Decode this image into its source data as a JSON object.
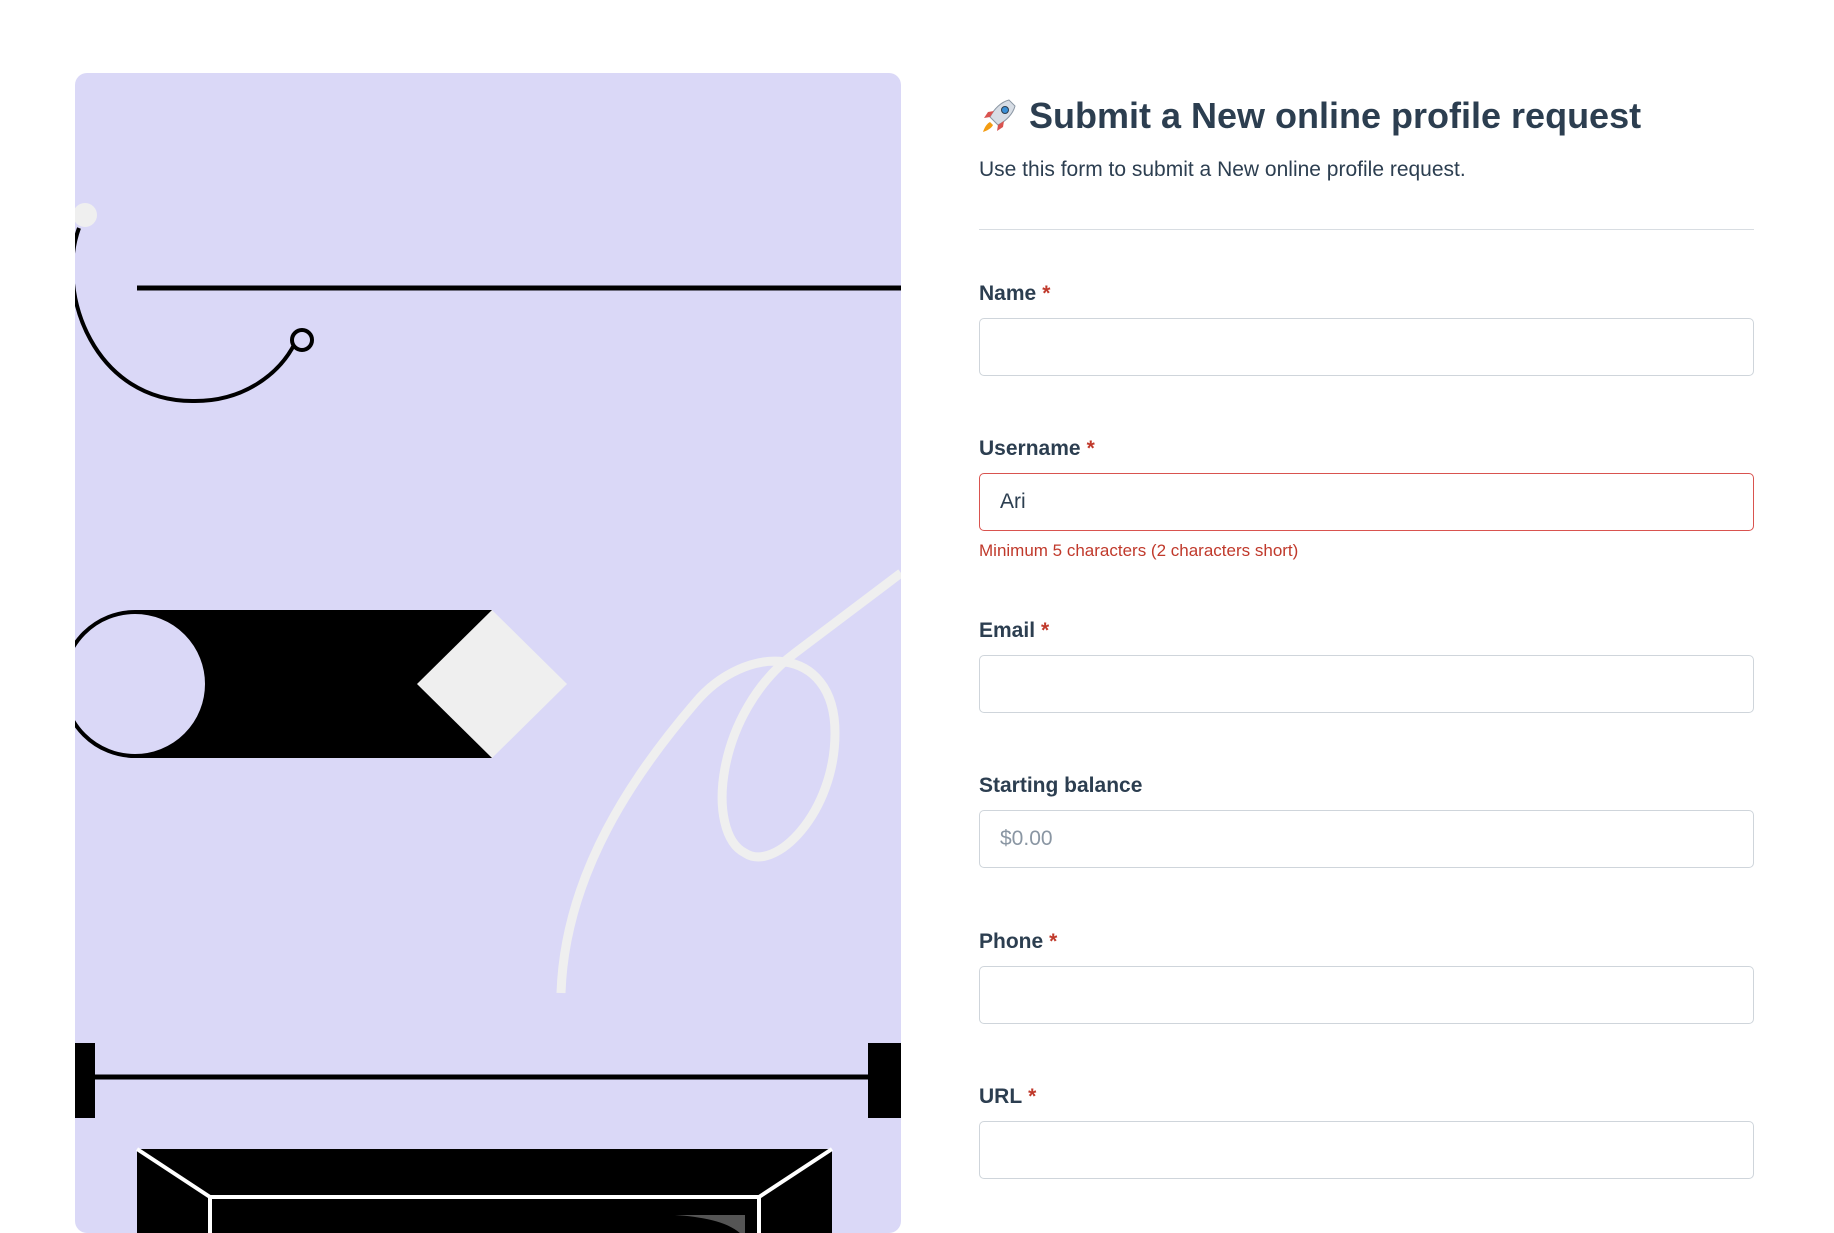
{
  "form": {
    "title": "Submit a New online profile request",
    "title_icon": "rocket-icon",
    "subtitle": "Use this form to submit a New online profile request.",
    "required_marker": "*",
    "fields": [
      {
        "label": "Name",
        "required": true,
        "value": "",
        "placeholder": ""
      },
      {
        "label": "Username",
        "required": true,
        "value": "Ari",
        "placeholder": "",
        "error": "Minimum 5 characters (2 characters short)"
      },
      {
        "label": "Email",
        "required": true,
        "value": "",
        "placeholder": ""
      },
      {
        "label": "Starting balance",
        "required": false,
        "value": "",
        "placeholder": "$0.00"
      },
      {
        "label": "Phone",
        "required": true,
        "value": "",
        "placeholder": ""
      },
      {
        "label": "URL",
        "required": true,
        "value": "",
        "placeholder": ""
      }
    ]
  },
  "colors": {
    "panel_background": "#dad8f7",
    "text": "#2c3e50",
    "error": "#c0392b",
    "input_border": "#cfd5db"
  }
}
